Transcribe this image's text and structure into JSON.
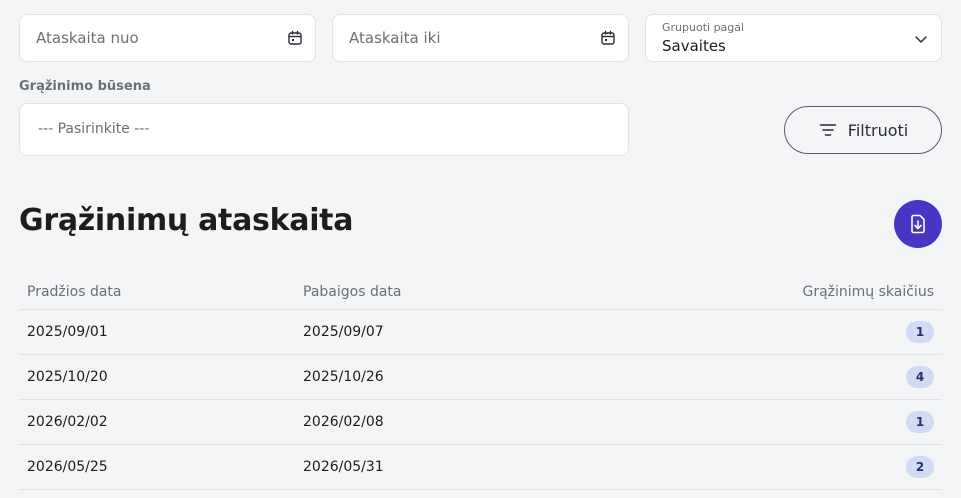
{
  "filters": {
    "date_from": {
      "value": "",
      "placeholder": "Ataskaita nuo",
      "icon": "calendar-icon"
    },
    "date_to": {
      "value": "",
      "placeholder": "Ataskaita iki",
      "icon": "calendar-icon"
    },
    "group_by": {
      "label": "Grupuoti pagal",
      "value": "Savaites",
      "icon": "chevron-down-icon"
    },
    "return_status": {
      "label": "Grąžinimo būsena",
      "value": "--- Pasirinkite ---"
    },
    "filter_button": {
      "label": "Filtruoti",
      "icon": "filter-lines-icon"
    }
  },
  "report": {
    "title": "Grąžinimų ataskaita",
    "download_icon": "file-download-icon",
    "accent_color": "#4736c4",
    "columns": [
      "Pradžios data",
      "Pabaigos data",
      "Grąžinimų skaičius"
    ],
    "rows": [
      {
        "start": "2025/09/01",
        "end": "2025/09/07",
        "count": "1"
      },
      {
        "start": "2025/10/20",
        "end": "2025/10/26",
        "count": "4"
      },
      {
        "start": "2026/02/02",
        "end": "2026/02/08",
        "count": "1"
      },
      {
        "start": "2026/05/25",
        "end": "2026/05/31",
        "count": "2"
      }
    ]
  }
}
